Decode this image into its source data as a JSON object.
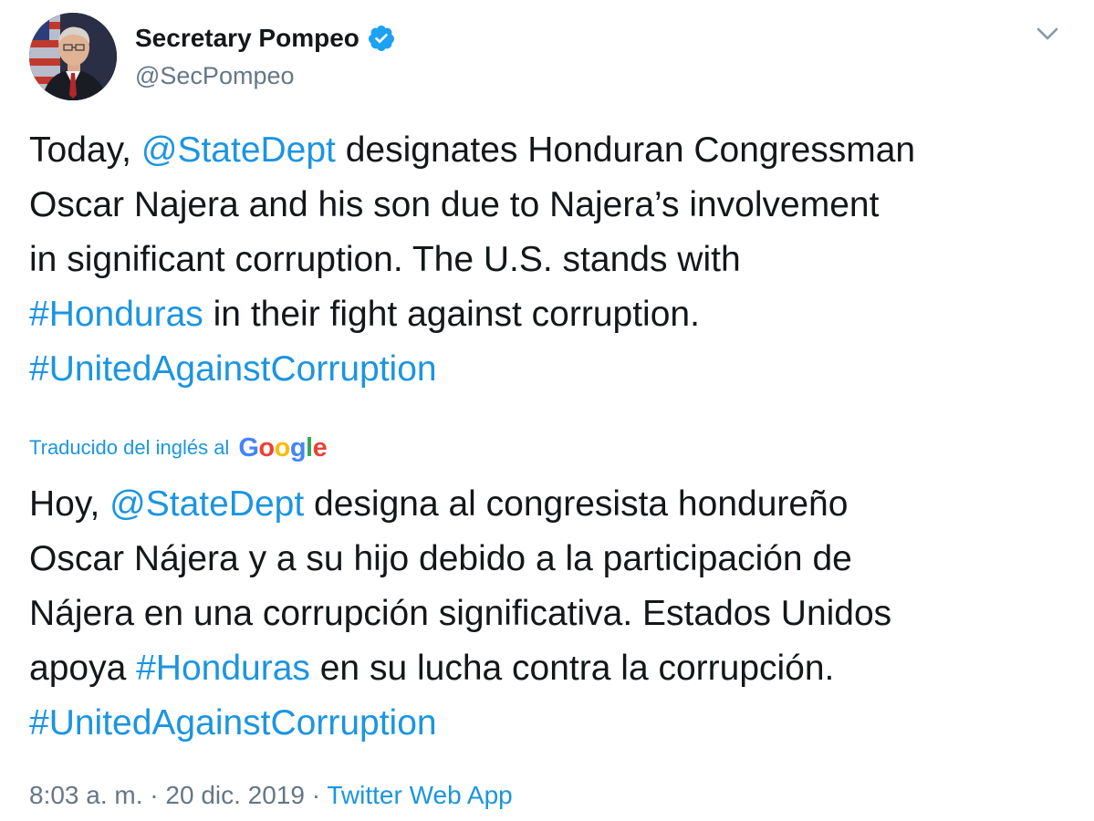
{
  "author": {
    "display_name": "Secretary Pompeo",
    "handle": "@SecPompeo",
    "verified": true
  },
  "tweet_en": {
    "line1": {
      "pre": "Today, ",
      "mention": "@StateDept",
      "post": " designates Honduran Congressman"
    },
    "line2": "Oscar Najera and his son due to Najera’s involvement",
    "line3": "in significant corruption. The U.S. stands with",
    "line4": {
      "hashtag": "#Honduras",
      "post": " in their fight against corruption."
    },
    "line5": "#UnitedAgainstCorruption"
  },
  "translation": {
    "label": "Traducido del inglés al",
    "provider": "Google",
    "provider_letters": [
      "G",
      "o",
      "o",
      "g",
      "l",
      "e"
    ]
  },
  "tweet_es": {
    "line1": {
      "pre": "Hoy, ",
      "mention": "@StateDept",
      "post": " designa al congresista hondureño"
    },
    "line2": "Oscar Nájera y a su hijo debido a la participación de",
    "line3": "Nájera en una corrupción significativa. Estados Unidos",
    "line4": {
      "pre": "apoya ",
      "hashtag": "#Honduras",
      "post": " en su lucha contra la corrupción."
    },
    "line5": "#UnitedAgainstCorruption"
  },
  "meta": {
    "time": "8:03 a. m.",
    "separator1": " · ",
    "date": "20 dic. 2019",
    "separator2": " · ",
    "source": "Twitter Web App"
  },
  "icons": {
    "verified": "verified-badge-icon",
    "caret": "chevron-down-icon",
    "avatar": "profile-photo"
  },
  "colors": {
    "link": "#1b95e0",
    "text": "#14171a",
    "secondary": "#657786"
  }
}
